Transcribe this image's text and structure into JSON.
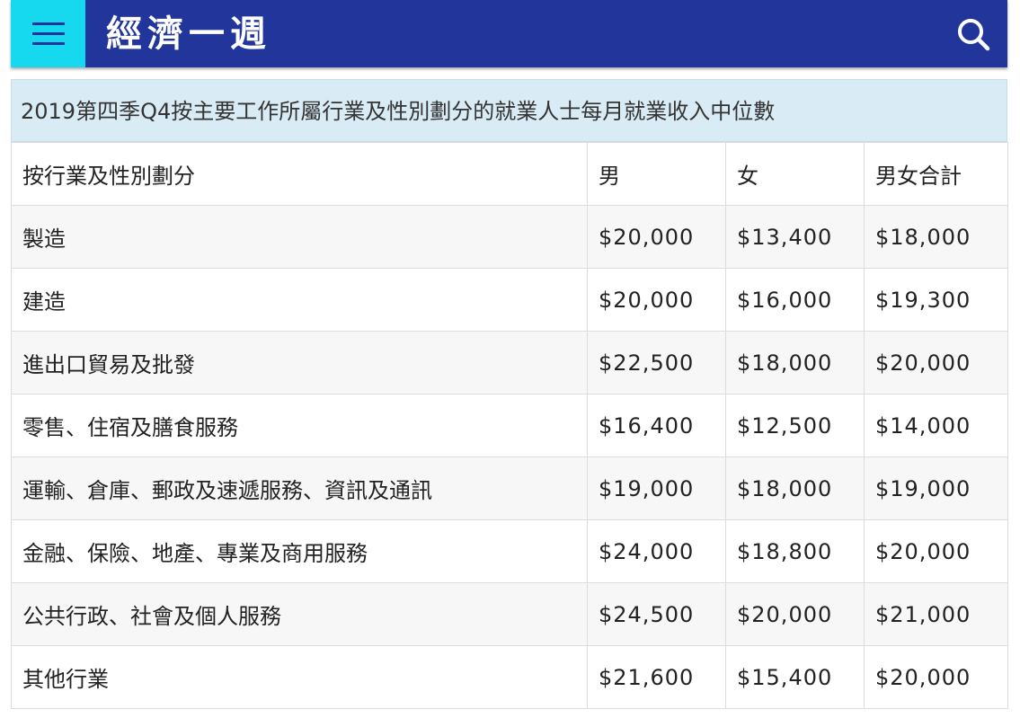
{
  "header": {
    "title": "經濟一週"
  },
  "table": {
    "caption": "2019第四季Q4按主要工作所屬行業及性別劃分的就業人士每月就業收入中位數",
    "headers": [
      "按行業及性別劃分",
      "男",
      "女",
      "男女合計"
    ],
    "rows": [
      [
        "製造",
        "$20,000",
        "$13,400",
        "$18,000"
      ],
      [
        "建造",
        "$20,000",
        "$16,000",
        "$19,300"
      ],
      [
        "進出口貿易及批發",
        "$22,500",
        "$18,000",
        "$20,000"
      ],
      [
        "零售、住宿及膳食服務",
        "$16,400",
        "$12,500",
        "$14,000"
      ],
      [
        "運輸、倉庫、郵政及速遞服務、資訊及通訊",
        "$19,000",
        "$18,000",
        "$19,000"
      ],
      [
        "金融、保險、地產、專業及商用服務",
        "$24,000",
        "$18,800",
        "$20,000"
      ],
      [
        "公共行政、社會及個人服務",
        "$24,500",
        "$20,000",
        "$21,000"
      ],
      [
        "其他行業",
        "$21,600",
        "$15,400",
        "$20,000"
      ]
    ]
  }
}
